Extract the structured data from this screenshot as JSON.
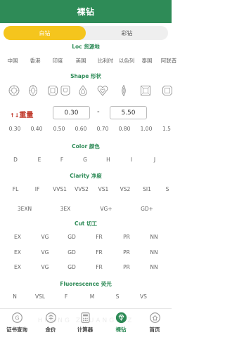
{
  "header": {
    "title": "裸钻"
  },
  "tabs": [
    {
      "label": "白钻",
      "active": true
    },
    {
      "label": "彩钻",
      "active": false
    }
  ],
  "loc": {
    "title": "Loc 货源地",
    "options": [
      "中国",
      "香港",
      "印度",
      "美国",
      "比利时",
      "以色列",
      "泰国",
      "阿联酋"
    ]
  },
  "shape": {
    "title": "Shape 形状",
    "icons": [
      "round-icon",
      "oval-icon",
      "cushion-icon",
      "heart-cushion-icon",
      "pear-icon",
      "heart-icon",
      "marquise-icon",
      "princess-icon",
      "emerald-icon"
    ]
  },
  "weight": {
    "label": "重量",
    "sort_icon": "↑↓",
    "min": "0.30",
    "max": "5.50",
    "dash": "-",
    "presets": [
      "0.30",
      "0.40",
      "0.50",
      "0.60",
      "0.70",
      "0.80",
      "1.00",
      "1.5"
    ]
  },
  "color": {
    "title": "Color 颜色",
    "options": [
      "D",
      "E",
      "F",
      "G",
      "H",
      "I",
      "J"
    ]
  },
  "clarity": {
    "title": "Clarity 净度",
    "row1": [
      "FL",
      "IF",
      "VVS1",
      "VVS2",
      "VS1",
      "VS2",
      "SI1",
      "S"
    ],
    "row2": [
      "3EXN",
      "3EX",
      "VG+",
      "GD+"
    ]
  },
  "cut": {
    "title": "Cut 切工",
    "rows": [
      [
        "EX",
        "VG",
        "GD",
        "FR",
        "PR",
        "NN"
      ],
      [
        "EX",
        "VG",
        "GD",
        "FR",
        "PR",
        "NN"
      ],
      [
        "EX",
        "VG",
        "GD",
        "FR",
        "PR",
        "NN"
      ]
    ]
  },
  "fluorescence": {
    "title": "Fluorescence 荧光",
    "options": [
      "N",
      "VSL",
      "F",
      "M",
      "S",
      "VS"
    ]
  },
  "watermark": "HUANG ZHUANG GZ",
  "bottom_nav": [
    {
      "label": "证书查询",
      "icon": "certificate-icon",
      "active": false
    },
    {
      "label": "金价",
      "icon": "gold-price-icon",
      "active": false
    },
    {
      "label": "计算器",
      "icon": "calculator-icon",
      "active": false
    },
    {
      "label": "裸钻",
      "icon": "diamond-icon",
      "active": true
    },
    {
      "label": "首页",
      "icon": "home-icon",
      "active": false
    }
  ],
  "colors": {
    "brand_green": "#2e8b57",
    "accent_yellow": "#f5c51d",
    "weight_red": "#c0392b"
  }
}
